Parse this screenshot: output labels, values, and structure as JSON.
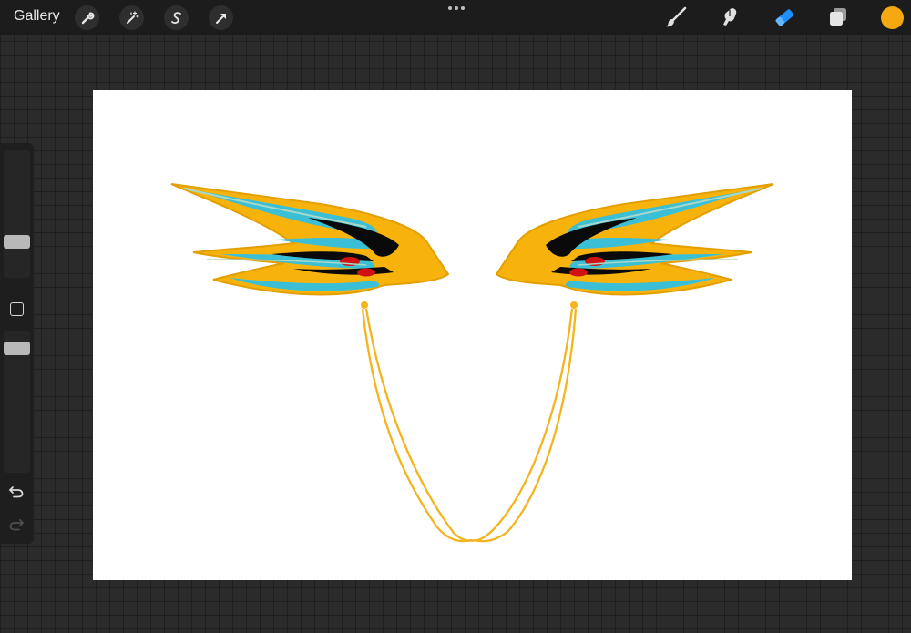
{
  "topbar": {
    "gallery_label": "Gallery",
    "left_tools": [
      {
        "icon": "wrench-icon",
        "name": "actions-button"
      },
      {
        "icon": "magic-wand-icon",
        "name": "adjustments-button"
      },
      {
        "icon": "selection-s-icon",
        "name": "selection-button"
      },
      {
        "icon": "arrow-cursor-icon",
        "name": "transform-button"
      }
    ],
    "more_icon": "more-dots-icon",
    "right_tools": [
      {
        "icon": "brush-icon",
        "name": "brush-tool",
        "active": false
      },
      {
        "icon": "smudge-icon",
        "name": "smudge-tool",
        "active": false
      },
      {
        "icon": "eraser-icon",
        "name": "eraser-tool",
        "active": true
      }
    ],
    "layers_icon": "layers-icon",
    "current_color": "#f5a80f"
  },
  "sidebar": {
    "size_slider_level": 0.5,
    "opacity_slider_level": 0.9,
    "modify_icon": "square-modify-icon",
    "undo_icon": "undo-icon",
    "redo_icon": "redo-icon",
    "redo_enabled": false
  },
  "colors": {
    "accent_active": "#1e90ff",
    "wing_gold": "#f7b30c",
    "wing_cyan": "#3bbfd6",
    "wing_black": "#0a0a0a",
    "wing_red": "#d01212",
    "background": "#2b2b2b"
  }
}
